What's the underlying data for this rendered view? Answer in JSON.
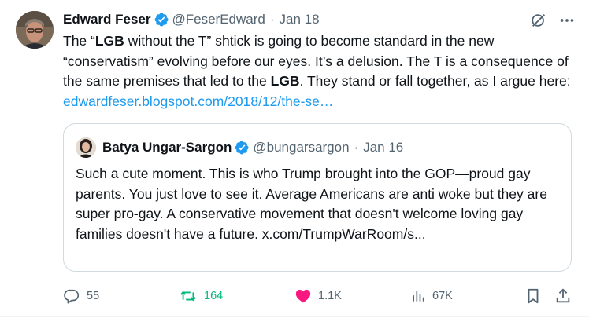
{
  "tweet": {
    "author": {
      "name": "Edward Feser",
      "handle": "@FeserEdward",
      "separator": "·",
      "date": "Jan 18"
    },
    "text": {
      "part1": "The “",
      "bold1": "LGB",
      "part2": " without the T” shtick is going to become standard in the new “conservatism” evolving before our eyes. It’s a delusion. The T is a consequence of the same premises that led to the ",
      "bold2": "LGB",
      "part3": ". They stand or fall together, as I argue here: ",
      "link": "edwardfeser.blogspot.com/2018/12/the-se…"
    },
    "quoted": {
      "name": "Batya Ungar-Sargon",
      "handle": "@bungarsargon",
      "separator": "·",
      "date": "Jan 16",
      "text": "Such a cute moment. This is who Trump brought into the GOP—proud gay parents. You just love to see it. Average Americans are anti woke but they are super pro-gay. A conservative movement that doesn't welcome loving gay families doesn't have a future. x.com/TrumpWarRoom/s..."
    },
    "actions": {
      "replies": "55",
      "retweets": "164",
      "likes": "1.1K",
      "views": "67K"
    }
  },
  "colors": {
    "text": "#0f1419",
    "secondary": "#536471",
    "link": "#1d9bf0",
    "verified": "#1d9bf0",
    "retweet": "#00ba7c",
    "like": "#f91880",
    "border": "#cfd9de"
  },
  "icons": {
    "verified": "verified-badge-icon",
    "grok": "grok-icon",
    "more": "more-icon",
    "reply": "reply-icon",
    "retweet": "retweet-icon",
    "like": "heart-icon",
    "views": "views-chart-icon",
    "bookmark": "bookmark-icon",
    "share": "share-icon"
  }
}
